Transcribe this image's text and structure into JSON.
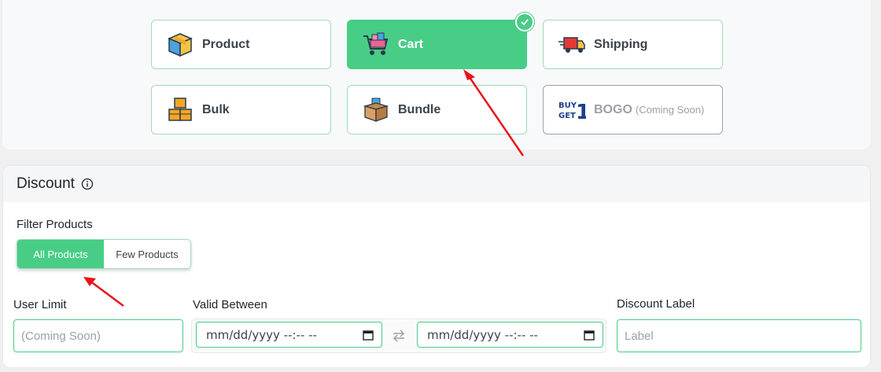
{
  "discount_types": [
    {
      "label": "Product",
      "icon": "box-icon"
    },
    {
      "label": "Cart",
      "icon": "shopping-cart-icon",
      "selected": true
    },
    {
      "label": "Shipping",
      "icon": "delivery-truck-icon"
    },
    {
      "label": "Bulk",
      "icon": "stacked-boxes-icon"
    },
    {
      "label": "Bundle",
      "icon": "open-box-icon"
    },
    {
      "label": "BOGO",
      "note": "(Coming Soon)",
      "icon": "buy-get-1-icon",
      "logo_text": "BUY GET 1",
      "disabled": true
    }
  ],
  "discount_section": {
    "title": "Discount",
    "filter_products": {
      "label": "Filter Products",
      "options": [
        "All Products",
        "Few Products"
      ],
      "selected": "All Products"
    },
    "user_limit": {
      "label": "User Limit",
      "placeholder": "(Coming Soon)"
    },
    "valid_between": {
      "label": "Valid Between",
      "start": "mm/dd/yyyy --:-- --",
      "end": "mm/dd/yyyy --:-- --"
    },
    "discount_label": {
      "label": "Discount Label",
      "placeholder": "Label"
    }
  },
  "colors": {
    "accent": "#48cd86",
    "annotation_arrow": "#e8141b"
  }
}
